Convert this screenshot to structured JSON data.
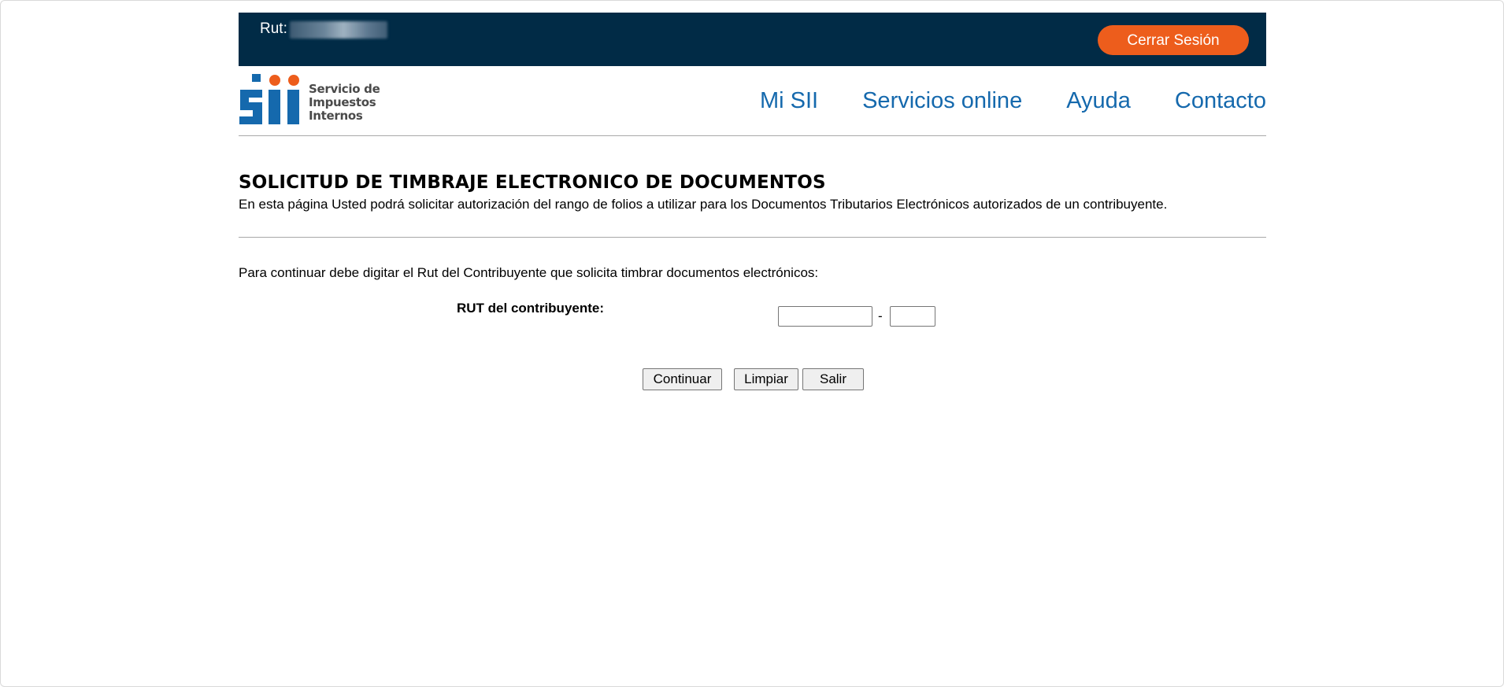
{
  "topbar": {
    "rut_label": "Rut:",
    "logout_label": "Cerrar Sesión",
    "colors": {
      "background": "#012b46",
      "logout": "#ed5d1c"
    }
  },
  "logo": {
    "line1": "Servicio de",
    "line2": "Impuestos",
    "line3": "Internos",
    "colors": {
      "blue": "#1569ad",
      "orange": "#ed5d1c"
    }
  },
  "nav": {
    "items": [
      {
        "label": "Mi SII"
      },
      {
        "label": "Servicios online"
      },
      {
        "label": "Ayuda"
      },
      {
        "label": "Contacto"
      }
    ]
  },
  "page": {
    "title": "SOLICITUD DE TIMBRAJE ELECTRONICO DE DOCUMENTOS",
    "subtitle": "En esta página Usted podrá solicitar autorización del rango de folios a utilizar para los Documentos Tributarios Electrónicos autorizados de un contribuyente.",
    "instruction": "Para continuar debe digitar el Rut del Contribuyente que solicita timbrar documentos electrónicos:"
  },
  "form": {
    "rut_label": "RUT del contribuyente:",
    "rut_value": "",
    "dash": "-",
    "dv_value": "",
    "buttons": {
      "continue": "Continuar",
      "clear": "Limpiar",
      "exit": "Salir"
    }
  }
}
